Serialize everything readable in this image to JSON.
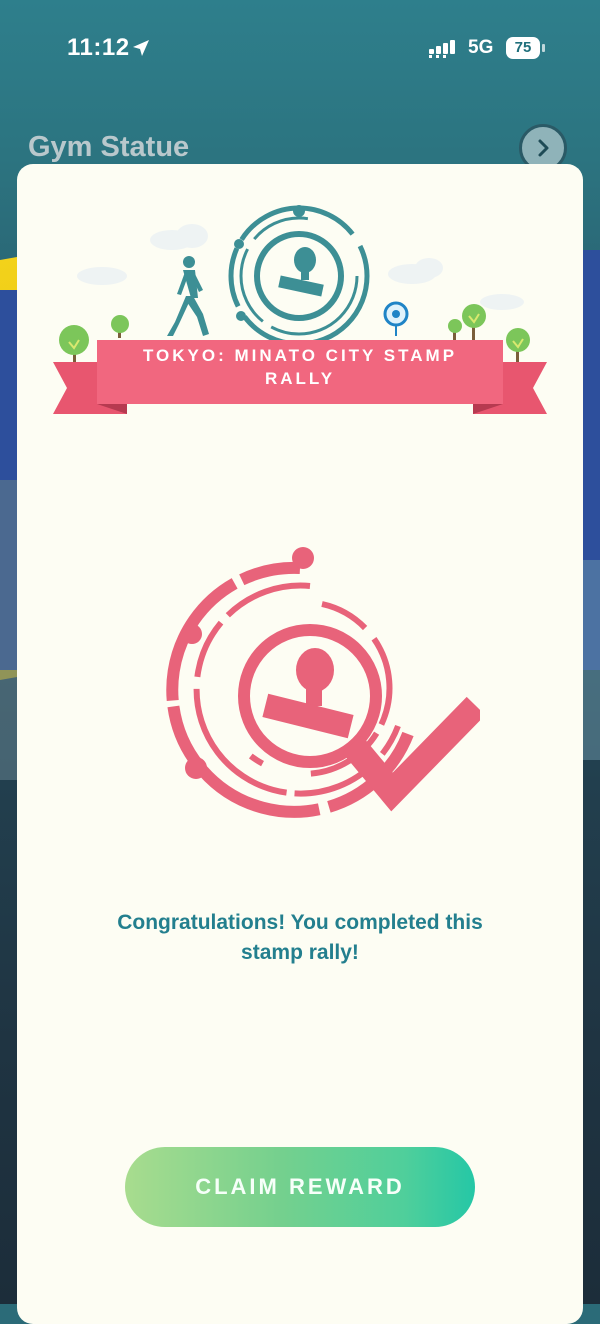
{
  "status_bar": {
    "time": "11:12",
    "network": "5G",
    "battery": "75",
    "icons": [
      "location-arrow-icon",
      "signal-bars-icon",
      "battery-icon"
    ]
  },
  "background": {
    "title": "Gym Statue",
    "next_icon": "chevron-right-icon"
  },
  "modal": {
    "banner_title": "TOKYO: MINATO CITY STAMP RALLY",
    "message": "Congratulations! You completed this stamp rally!",
    "claim_label": "CLAIM REWARD",
    "icons": [
      "stamp-emblem-icon",
      "walking-person-icon",
      "pokestop-icon",
      "tree-icon",
      "completed-stamp-icon",
      "checkmark-icon"
    ]
  },
  "colors": {
    "accent_teal": "#237f8e",
    "ribbon_pink": "#f1677f",
    "stamp_pink": "#e8637a",
    "button_green_start": "#a8dc8e",
    "button_green_end": "#25c7a6",
    "modal_bg": "#fdfdf3"
  }
}
